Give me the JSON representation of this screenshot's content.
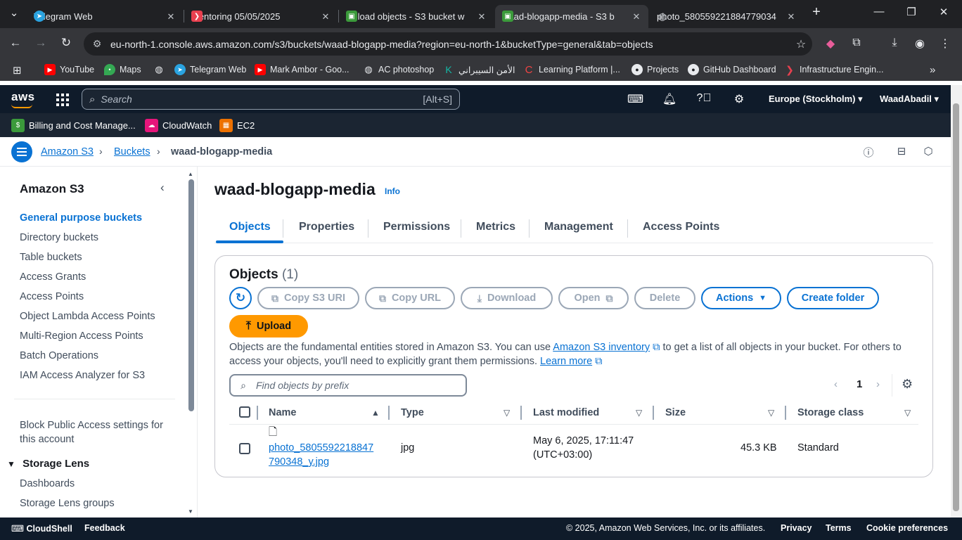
{
  "browser": {
    "tabs": [
      {
        "title": "Telegram Web"
      },
      {
        "title": "Mentoring 05/05/2025"
      },
      {
        "title": "Upload objects - S3 bucket w"
      },
      {
        "title": "waad-blogapp-media - S3 b"
      },
      {
        "title": "photo_580559221884779034"
      }
    ],
    "url": "eu-north-1.console.aws.amazon.com/s3/buckets/waad-blogapp-media?region=eu-north-1&bucketType=general&tab=objects",
    "bookmarks": [
      {
        "label": "YouTube"
      },
      {
        "label": "Maps"
      },
      {
        "label": "Telegram Web"
      },
      {
        "label": "Mark Ambor - Goo..."
      },
      {
        "label": "AC photoshop"
      },
      {
        "label": "الأمن السيبراني"
      },
      {
        "label": "Learning Platform |..."
      },
      {
        "label": "Projects"
      },
      {
        "label": "GitHub Dashboard"
      },
      {
        "label": "Infrastructure Engin..."
      }
    ]
  },
  "aws": {
    "logo": "aws",
    "search_placeholder": "Search",
    "search_shortcut": "[Alt+S]",
    "region": "Europe (Stockholm)",
    "account": "WaadAbadil",
    "favorites": [
      "Billing and Cost Manage...",
      "CloudWatch",
      "EC2"
    ]
  },
  "breadcrumbs": [
    "Amazon S3",
    "Buckets",
    "waad-blogapp-media"
  ],
  "sidebar": {
    "title": "Amazon S3",
    "items": [
      "General purpose buckets",
      "Directory buckets",
      "Table buckets",
      "Access Grants",
      "Access Points",
      "Object Lambda Access Points",
      "Multi-Region Access Points",
      "Batch Operations",
      "IAM Access Analyzer for S3"
    ],
    "block_public_1": "Block Public Access settings for",
    "block_public_2": "this account",
    "section": "Storage Lens",
    "section_items": [
      "Dashboards",
      "Storage Lens groups"
    ]
  },
  "main": {
    "title": "waad-blogapp-media",
    "info": "Info",
    "tabs": [
      "Objects",
      "Properties",
      "Permissions",
      "Metrics",
      "Management",
      "Access Points"
    ],
    "panel": {
      "title": "Objects",
      "count": "(1)",
      "buttons": {
        "copy_uri": "Copy S3 URI",
        "copy_url": "Copy URL",
        "download": "Download",
        "open": "Open",
        "delete": "Delete",
        "actions": "Actions",
        "create_folder": "Create folder",
        "upload": "Upload"
      },
      "desc_1": "Objects are the fundamental entities stored in Amazon S3. You can use ",
      "desc_link": "Amazon S3 inventory",
      "desc_2": " to get a list of all objects in your bucket. For others to access your objects, you'll need to explicitly grant them permissions. ",
      "desc_learn": "Learn more",
      "search_placeholder": "Find objects by prefix",
      "page": "1",
      "columns": [
        "Name",
        "Type",
        "Last modified",
        "Size",
        "Storage class"
      ],
      "rows": [
        {
          "name_1": "photo_5805592218847",
          "name_2": "790348_y.jpg",
          "type": "jpg",
          "modified_1": "May 6, 2025, 17:11:47",
          "modified_2": "(UTC+03:00)",
          "size": "45.3 KB",
          "storage_class": "Standard"
        }
      ]
    }
  },
  "footer": {
    "cloudshell": "CloudShell",
    "feedback": "Feedback",
    "copyright": "© 2025, Amazon Web Services, Inc. or its affiliates.",
    "privacy": "Privacy",
    "terms": "Terms",
    "cookies": "Cookie preferences"
  }
}
